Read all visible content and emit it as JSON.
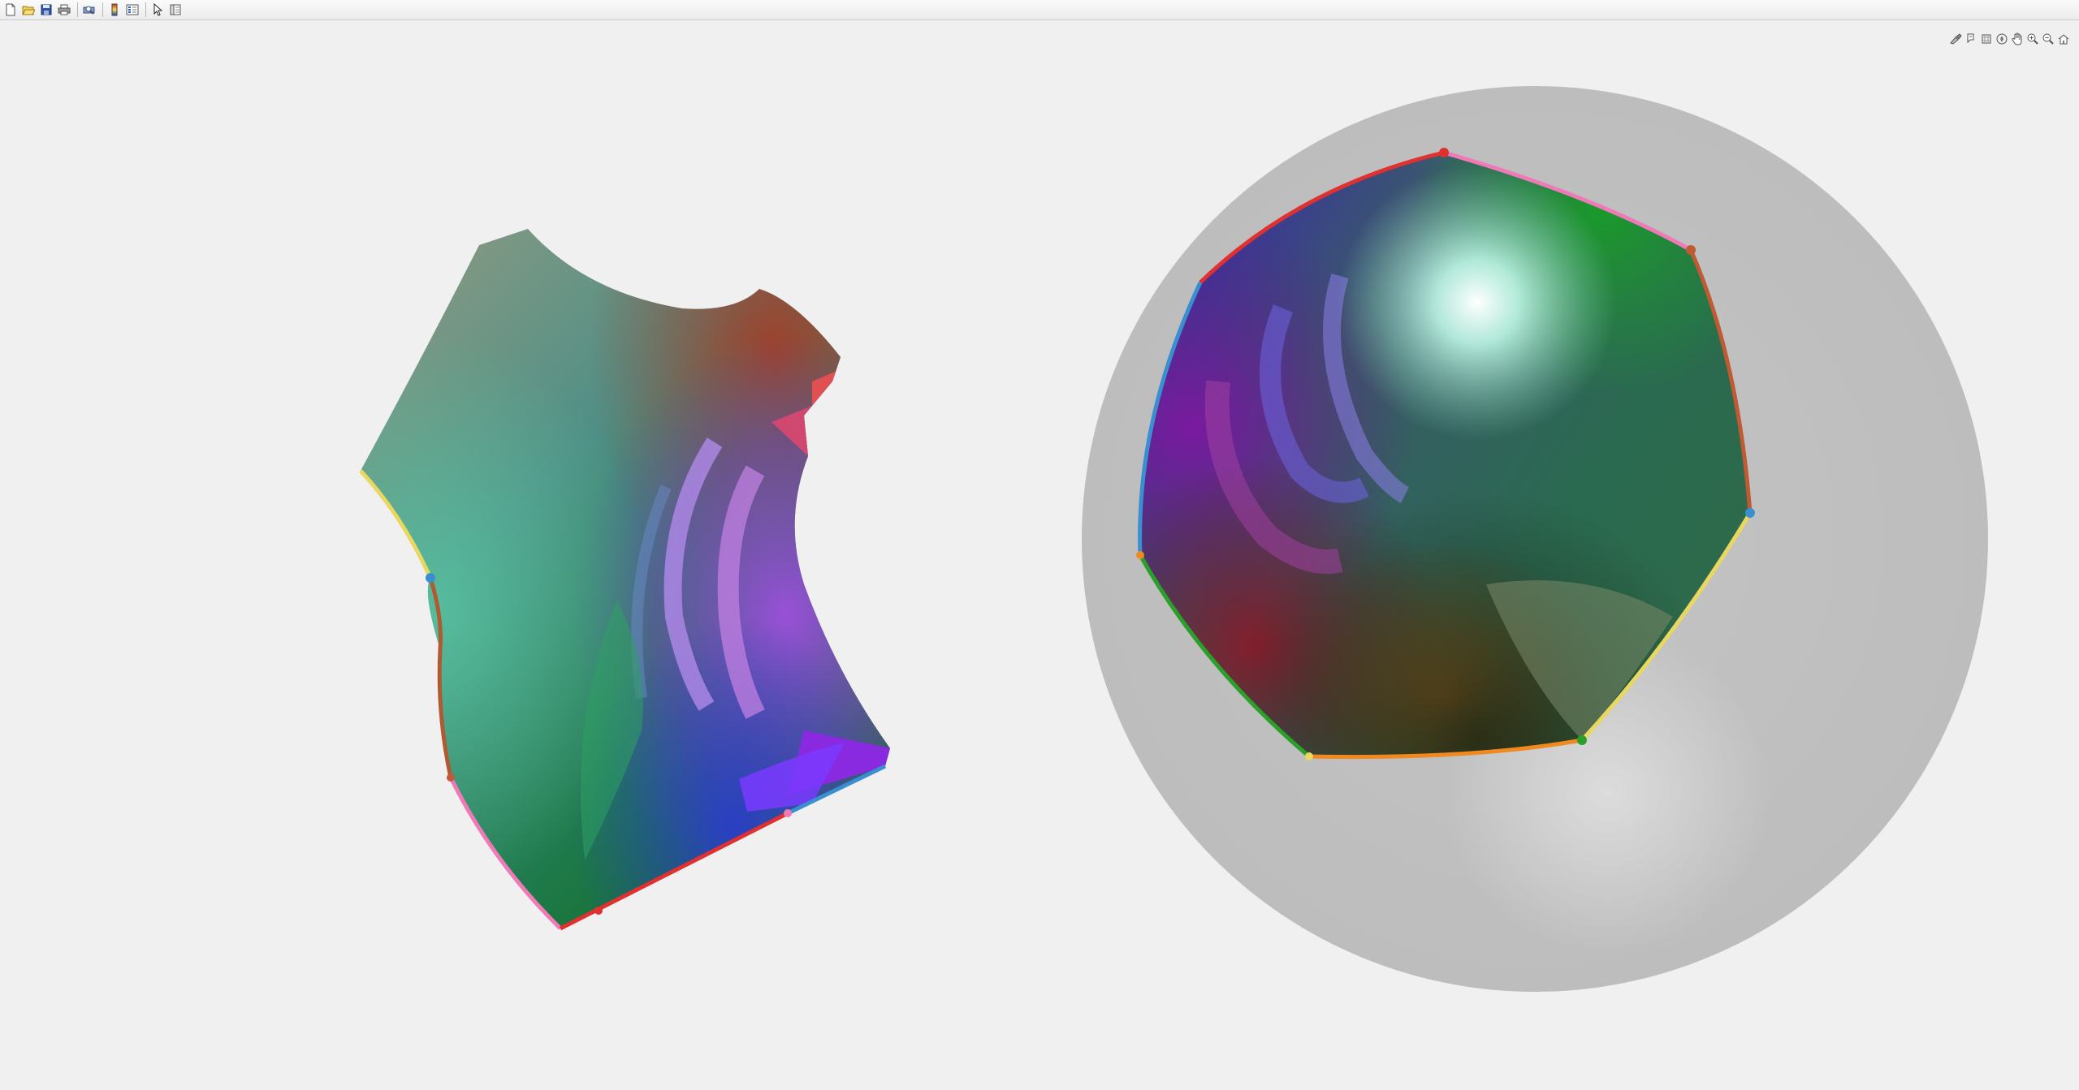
{
  "window": {
    "background": "#f0f0f0"
  },
  "figure_toolbar": {
    "buttons": [
      {
        "name": "new-figure-icon"
      },
      {
        "name": "open-file-icon"
      },
      {
        "name": "save-icon"
      },
      {
        "name": "print-icon"
      },
      {
        "name": "print-preview-icon"
      },
      {
        "name": "colorbar-icon"
      },
      {
        "name": "legend-icon"
      },
      {
        "name": "select-pointer-icon"
      },
      {
        "name": "property-editor-icon"
      }
    ]
  },
  "axes_toolbar": {
    "buttons": [
      {
        "name": "brush-icon"
      },
      {
        "name": "data-tips-icon"
      },
      {
        "name": "rotate-3d-icon"
      },
      {
        "name": "pan-icon"
      },
      {
        "name": "zoom-in-icon"
      },
      {
        "name": "zoom-out-icon"
      },
      {
        "name": "restore-view-icon"
      }
    ]
  },
  "plot": {
    "left_object": "colored-polyhedral-patch",
    "right_object": "colored-sphere-patch",
    "sphere_color": "#c2c2c2",
    "edge_colors": [
      "#e03030",
      "#f07ab8",
      "#3a8fd0",
      "#e8d860",
      "#b05a32",
      "#2aa02a",
      "#f08a20"
    ]
  }
}
